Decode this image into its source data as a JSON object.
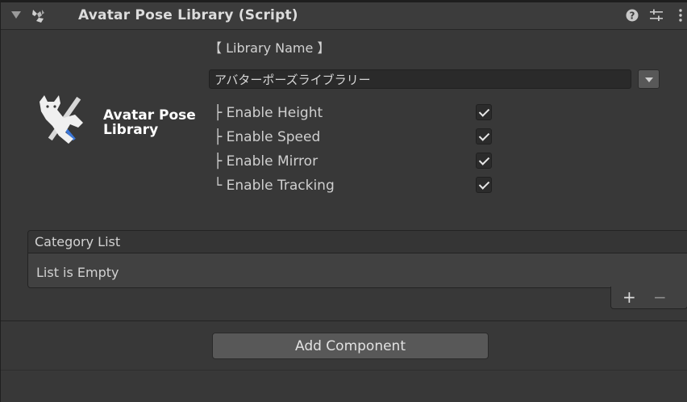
{
  "header": {
    "title": "Avatar Pose Library (Script)",
    "icons": {
      "fold": "fold-arrow-icon",
      "script": "script-icon",
      "help": "help-icon",
      "settings": "preset-settings-icon",
      "more": "more-options-icon"
    }
  },
  "logo": {
    "line1": "Avatar Pose",
    "line2": "Library"
  },
  "library_name": {
    "label": "【 Library Name 】",
    "value": "アバターポーズライブラリー"
  },
  "options": [
    {
      "prefix": "├",
      "label": "Enable Height",
      "checked": true
    },
    {
      "prefix": "├",
      "label": "Enable Speed",
      "checked": true
    },
    {
      "prefix": "├",
      "label": "Enable Mirror",
      "checked": true
    },
    {
      "prefix": "└",
      "label": "Enable Tracking",
      "checked": true
    }
  ],
  "category_list": {
    "title": "Category List",
    "empty_text": "List is Empty",
    "add_label": "+",
    "remove_label": "−"
  },
  "add_component": {
    "label": "Add Component"
  },
  "colors": {
    "background": "#383838",
    "header": "#3c3c3c",
    "text": "#d2d2d2",
    "button": "#585858"
  }
}
